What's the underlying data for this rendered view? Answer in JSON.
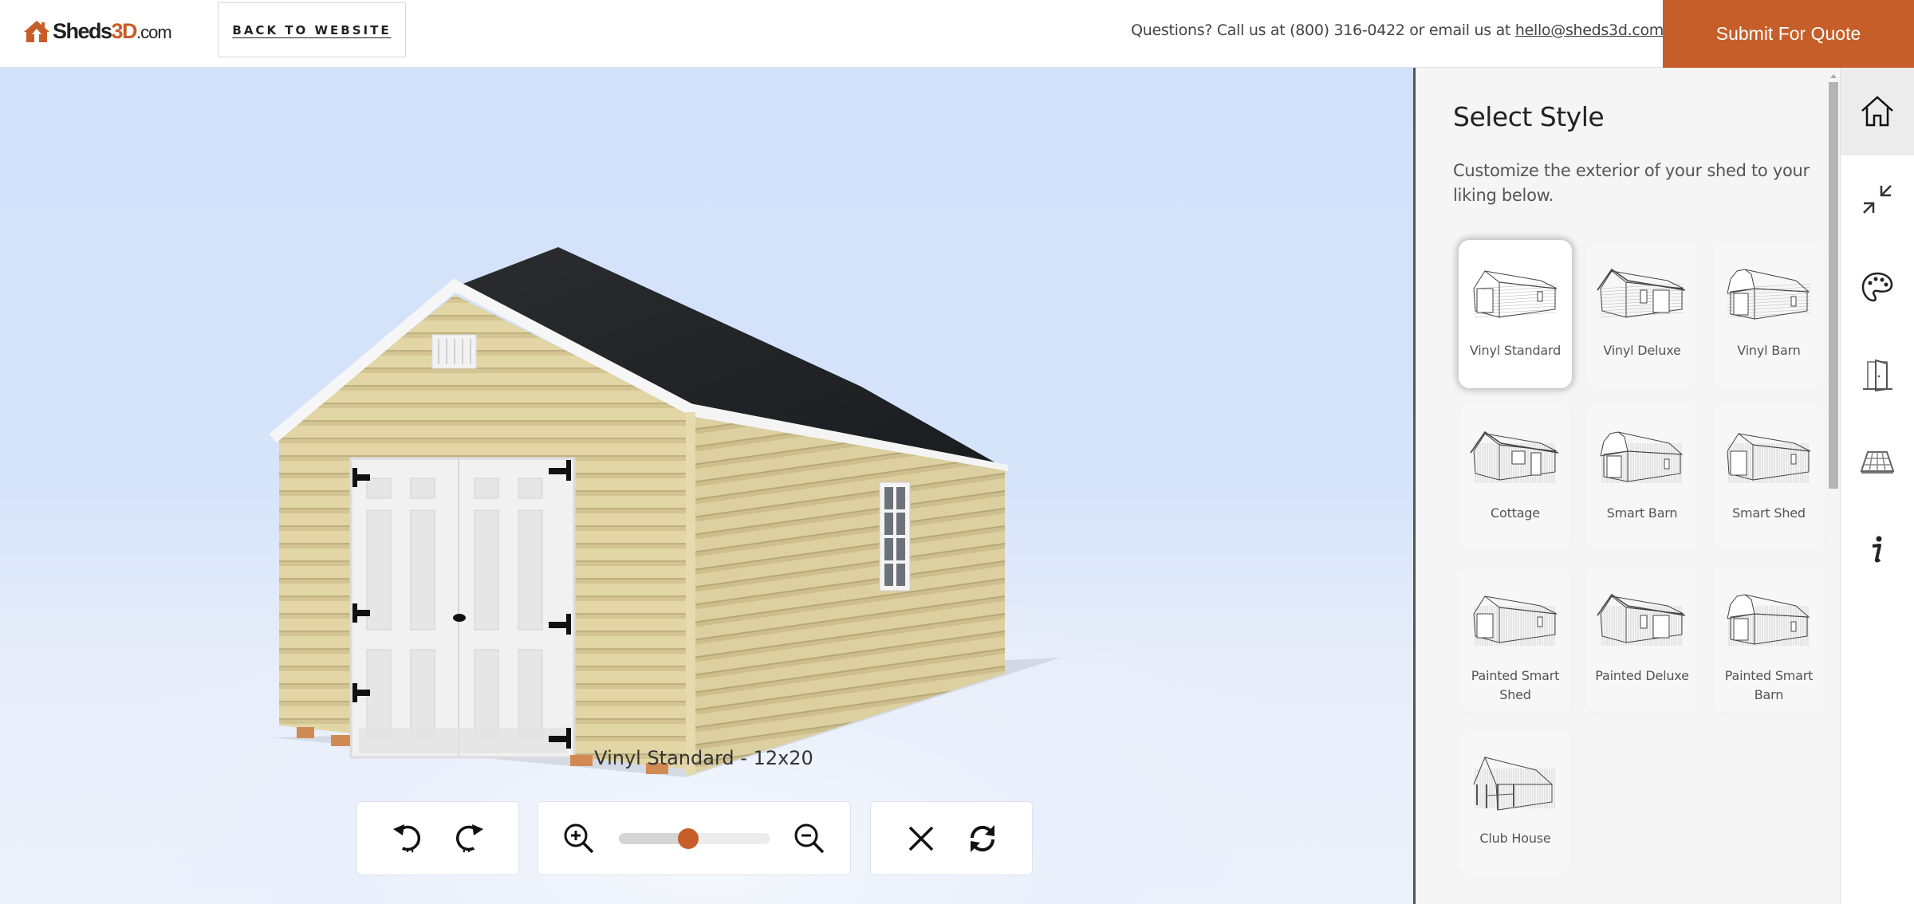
{
  "header": {
    "logo": {
      "prefix": "Sheds",
      "highlight": "3D",
      "suffix": ".com"
    },
    "back_button": "BACK TO WEBSITE",
    "contact_prefix": "Questions? Call us at (800) 316-0422 or email us at ",
    "contact_email": "hello@sheds3d.com",
    "submit_button": "Submit For Quote"
  },
  "colors": {
    "accent": "#c65e29",
    "viewport_sky": "#d2e1fa",
    "panel_bg": "#f5f5f5"
  },
  "viewport": {
    "model_label": "Vinyl Standard - 12x20",
    "toolbar": {
      "rotate_left": "rotate-left-icon",
      "rotate_right": "rotate-right-icon",
      "zoom_in": "zoom-in-icon",
      "zoom_out": "zoom-out-icon",
      "zoom_level_fraction": 0.46,
      "close": "close-icon",
      "reset": "refresh-icon"
    }
  },
  "panel": {
    "title": "Select Style",
    "description": "Customize the exterior of your shed to your liking below.",
    "selected_style": "Vinyl Standard",
    "styles": [
      {
        "label": "Vinyl Standard",
        "icon": "gable",
        "siding": "horizontal",
        "selected": true
      },
      {
        "label": "Vinyl Deluxe",
        "icon": "deluxe",
        "siding": "horizontal",
        "selected": false
      },
      {
        "label": "Vinyl Barn",
        "icon": "barn",
        "siding": "horizontal",
        "selected": false
      },
      {
        "label": "Cottage",
        "icon": "cottage",
        "siding": "vertical",
        "selected": false
      },
      {
        "label": "Smart Barn",
        "icon": "barn",
        "siding": "vertical",
        "selected": false
      },
      {
        "label": "Smart Shed",
        "icon": "gable",
        "siding": "vertical",
        "selected": false
      },
      {
        "label": "Painted Smart Shed",
        "icon": "gable",
        "siding": "vertical",
        "selected": false
      },
      {
        "label": "Painted Deluxe",
        "icon": "deluxe",
        "siding": "vertical",
        "selected": false
      },
      {
        "label": "Painted Smart Barn",
        "icon": "barn",
        "siding": "vertical",
        "selected": false
      },
      {
        "label": "Club House",
        "icon": "clubhouse",
        "siding": "vertical",
        "selected": false
      }
    ]
  },
  "rail": {
    "items": [
      {
        "name": "home",
        "icon": "home-icon",
        "active": true
      },
      {
        "name": "collapse",
        "icon": "collapse-icon",
        "active": false
      },
      {
        "name": "colors",
        "icon": "palette-icon",
        "active": false
      },
      {
        "name": "doors",
        "icon": "door-icon",
        "active": false
      },
      {
        "name": "flooring",
        "icon": "floor-icon",
        "active": false
      },
      {
        "name": "info",
        "icon": "info-icon",
        "active": false
      }
    ]
  }
}
